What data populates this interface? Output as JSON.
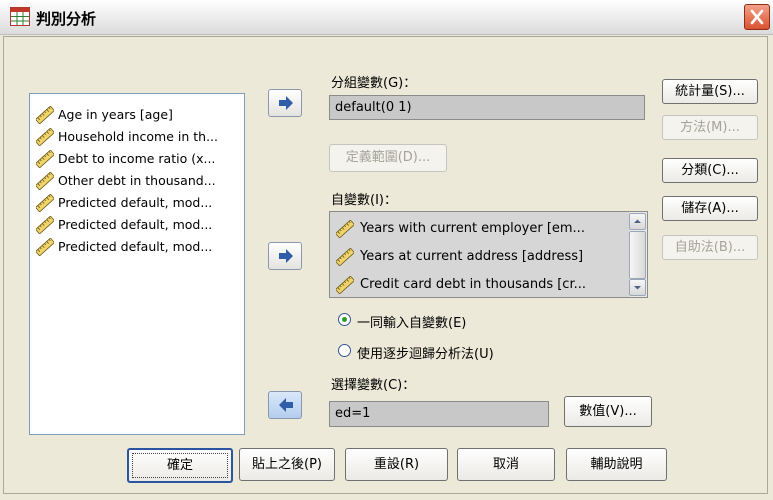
{
  "window": {
    "title": "判別分析"
  },
  "source_list": {
    "items": [
      {
        "label": "Age in years [age]",
        "icon": "scale-variable-icon"
      },
      {
        "label": "Household income in th...",
        "icon": "scale-variable-icon"
      },
      {
        "label": "Debt to income ratio (x...",
        "icon": "scale-variable-icon"
      },
      {
        "label": "Other debt in thousand...",
        "icon": "scale-variable-icon"
      },
      {
        "label": "Predicted default, mod...",
        "icon": "scale-variable-icon"
      },
      {
        "label": "Predicted default, mod...",
        "icon": "scale-variable-icon"
      },
      {
        "label": "Predicted default, mod...",
        "icon": "scale-variable-icon"
      }
    ]
  },
  "grouping": {
    "label": "分組變數(G)：",
    "value": "default(0 1)",
    "define_range_label": "定義範圍(D)..."
  },
  "independents": {
    "label": "自變數(I)：",
    "items": [
      {
        "label": "Years with current employer [em...",
        "icon": "scale-variable-icon"
      },
      {
        "label": "Years at current address [address]",
        "icon": "scale-variable-icon"
      },
      {
        "label": "Credit card debt in thousands [cr...",
        "icon": "scale-variable-icon"
      }
    ],
    "method_options": [
      {
        "label": "一同輸入自變數(E)",
        "checked": true
      },
      {
        "label": "使用逐步迴歸分析法(U)",
        "checked": false
      }
    ]
  },
  "selection": {
    "label": "選擇變數(C)：",
    "value": "ed=1",
    "value_button_label": "數值(V)..."
  },
  "side_buttons": {
    "statistics": "統計量(S)...",
    "method": "方法(M)...",
    "classify": "分類(C)...",
    "save": "儲存(A)...",
    "bootstrap": "自助法(B)..."
  },
  "bottom_buttons": {
    "ok": "確定",
    "paste": "貼上之後(P)",
    "reset": "重設(R)",
    "cancel": "取消",
    "help": "輔助說明"
  },
  "colors": {
    "dialog_bg": "#ece9d8",
    "field_bg": "#c8c8c8",
    "close_red": "#d9532f",
    "arrow_blue": "#2f5da8"
  }
}
